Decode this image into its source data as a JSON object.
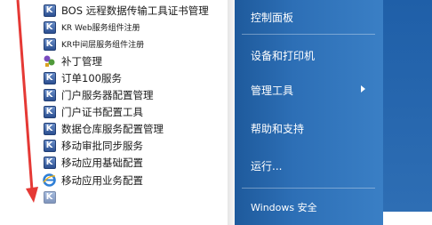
{
  "programs": [
    {
      "label": "BOS 远程数据传输工具证书管理",
      "icon": "kingdee-icon"
    },
    {
      "label": "KR Web服务组件注册",
      "icon": "kingdee-icon"
    },
    {
      "label": "KR中间层服务组件注册",
      "icon": "kingdee-icon"
    },
    {
      "label": "补丁管理",
      "icon": "patch-icon"
    },
    {
      "label": "订单100服务",
      "icon": "kingdee-icon"
    },
    {
      "label": "门户服务器配置管理",
      "icon": "kingdee-icon"
    },
    {
      "label": "门户证书配置工具",
      "icon": "kingdee-icon"
    },
    {
      "label": "数据仓库服务配置管理",
      "icon": "kingdee-icon"
    },
    {
      "label": "移动审批同步服务",
      "icon": "kingdee-icon"
    },
    {
      "label": "移动应用基础配置",
      "icon": "kingdee-icon"
    },
    {
      "label": "移动应用业务配置",
      "icon": "ie-icon"
    },
    {
      "label": "",
      "icon": "kingdee-icon"
    }
  ],
  "right_menu": {
    "control_panel": "控制面板",
    "devices_printers": "设备和打印机",
    "admin_tools": "管理工具",
    "help_support": "帮助和支持",
    "run": "运行...",
    "windows_security": "Windows 安全"
  },
  "colors": {
    "menu_blue": "#2d6fb6",
    "arrow_red": "#e53935",
    "icon_blue": "#2b4f91"
  }
}
